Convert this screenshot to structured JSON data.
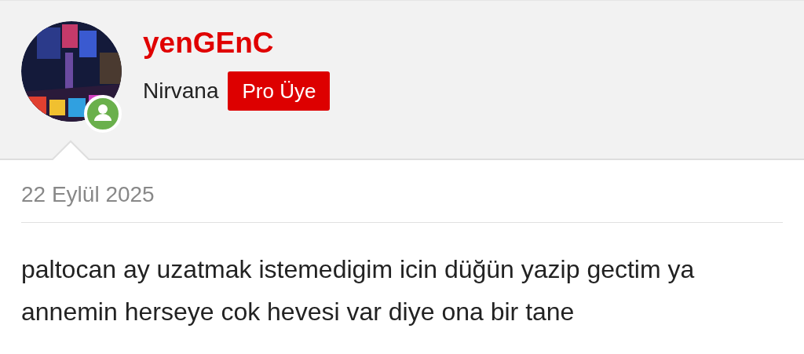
{
  "author": {
    "name": "yenGEnC",
    "online": true,
    "rank": "Nirvana",
    "badge": "Pro Üye"
  },
  "post": {
    "date": "22 Eylül 2025",
    "body": "paltocan ay uzatmak istemedigim icin düğün yazip gectim ya\nannemin herseye cok hevesi var diye ona bir tane"
  }
}
